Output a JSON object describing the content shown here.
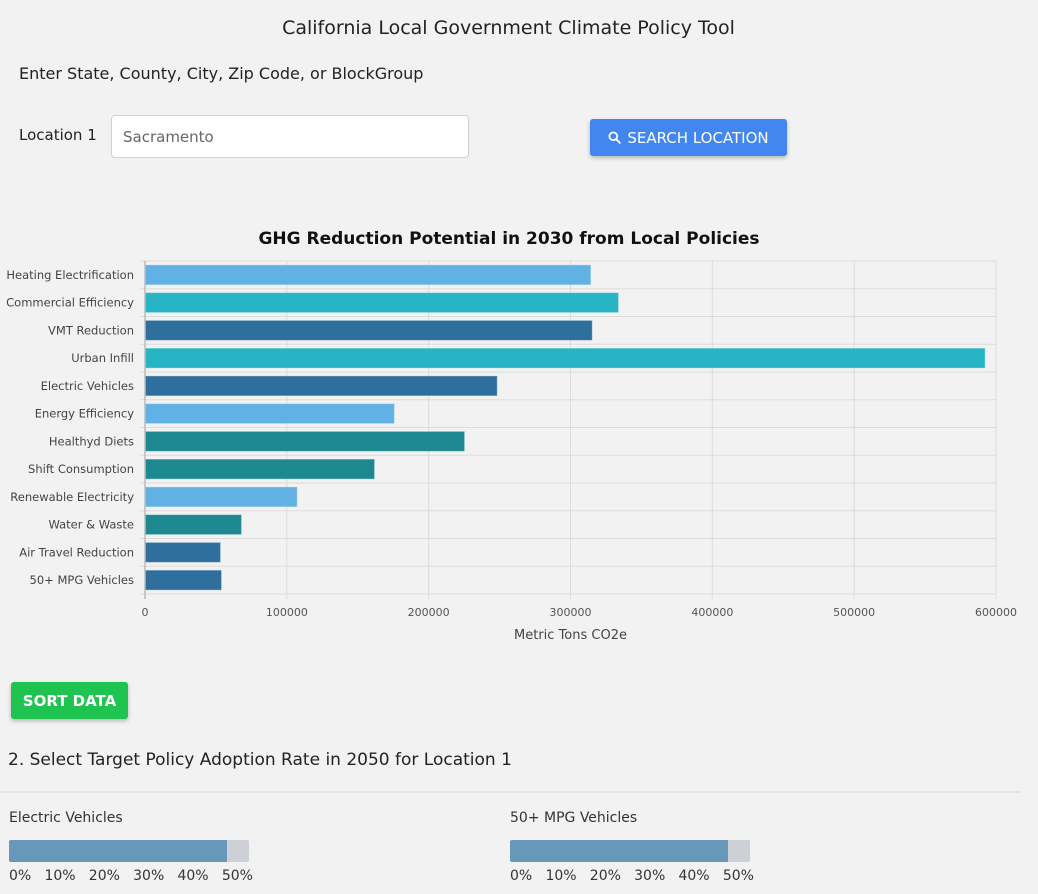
{
  "app": {
    "title": "California Local Government Climate Policy Tool",
    "prompt": "Enter State, County, City, Zip Code, or BlockGroup"
  },
  "location": {
    "label": "Location 1",
    "value": "Sacramento",
    "search_button": "SEARCH LOCATION",
    "search_icon": "search-icon"
  },
  "colors": {
    "light_blue": "#62b1e4",
    "cyan": "#27b5c6",
    "dark_blue": "#2e6f9e",
    "teal": "#1e8891",
    "search_button": "#4286f0",
    "sort_button": "#1fc34f",
    "slider_fill": "#6898b9",
    "slider_track": "#cdd0d4"
  },
  "chart_data": {
    "type": "bar",
    "orientation": "horizontal",
    "title": "GHG Reduction Potential in 2030 from Local Policies",
    "xlabel": "Metric Tons CO2e",
    "ylabel": "",
    "xlim": [
      0,
      600000
    ],
    "xticks": [
      0,
      100000,
      200000,
      300000,
      400000,
      500000,
      600000
    ],
    "xtick_labels": [
      "0",
      "100000",
      "200000",
      "300000",
      "400000",
      "500000",
      "600000"
    ],
    "grid": true,
    "legend": "none",
    "categories": [
      "Heating Electrification",
      "Commercial Efficiency",
      "VMT Reduction",
      "Urban Infill",
      "Electric Vehicles",
      "Energy Efficiency",
      "Healthyd Diets",
      "Shift Consumption",
      "Renewable Electricity",
      "Water & Waste",
      "Air Travel Reduction",
      "50+ MPG Vehicles"
    ],
    "values": [
      314000,
      333500,
      315000,
      592000,
      248000,
      175500,
      225000,
      161500,
      107000,
      67700,
      52900,
      53600
    ],
    "bar_colors": [
      "#62b1e4",
      "#27b5c6",
      "#2e6f9e",
      "#27b5c6",
      "#2e6f9e",
      "#62b1e4",
      "#1e8891",
      "#1e8891",
      "#62b1e4",
      "#1e8891",
      "#2e6f9e",
      "#2e6f9e"
    ]
  },
  "sort_button": "SORT DATA",
  "adoption": {
    "title": "2. Select Target Policy Adoption Rate in 2050 for Location 1",
    "ticks": [
      "0%",
      "10%",
      "20%",
      "30%",
      "40%",
      "50%"
    ],
    "sliders": [
      {
        "label": "Electric Vehicles",
        "value_percent": 45.5,
        "max_percent": 50
      },
      {
        "label": "50+ MPG Vehicles",
        "value_percent": 45.5,
        "max_percent": 50
      }
    ]
  }
}
